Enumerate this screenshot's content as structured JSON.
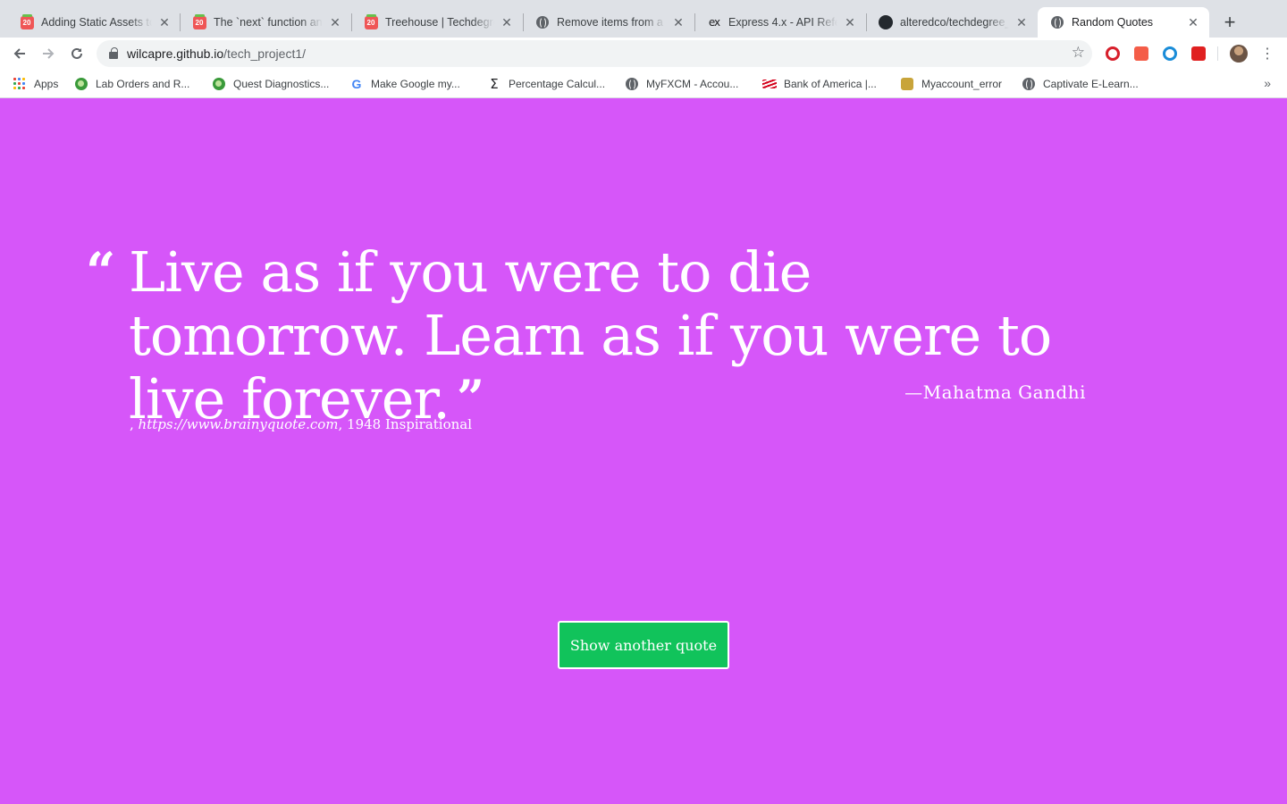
{
  "browser": {
    "tabs": [
      {
        "title": "Adding Static Assets to",
        "favicon": "treehouse-icon",
        "active": false
      },
      {
        "title": "The `next` function an",
        "favicon": "treehouse-icon",
        "active": false
      },
      {
        "title": "Treehouse | Techdegree",
        "favicon": "treehouse-icon",
        "active": false
      },
      {
        "title": "Remove items from a c",
        "favicon": "globe-icon",
        "active": false
      },
      {
        "title": "Express 4.x - API Refer",
        "favicon": "express-icon",
        "active": false
      },
      {
        "title": "alteredco/techdegree_",
        "favicon": "github-icon",
        "active": false
      },
      {
        "title": "Random Quotes",
        "favicon": "globe-icon",
        "active": true
      }
    ],
    "treehouse_badge": "20",
    "express_badge": "ex",
    "new_tab_label": "+",
    "address": {
      "host": "wilcapre.github.io",
      "path": "/tech_project1/"
    },
    "bookmarks": [
      {
        "label": "Apps",
        "icon": "apps-grid-icon"
      },
      {
        "label": "Lab Orders and R...",
        "icon": "green-leaf-icon"
      },
      {
        "label": "Quest Diagnostics...",
        "icon": "green-leaf-icon"
      },
      {
        "label": "Make Google my...",
        "icon": "google-icon"
      },
      {
        "label": "Percentage Calcul...",
        "icon": "sigma-icon"
      },
      {
        "label": "MyFXCM - Accou...",
        "icon": "globe-icon"
      },
      {
        "label": "Bank of America |...",
        "icon": "bank-of-america-icon"
      },
      {
        "label": "Myaccount_error",
        "icon": "user-badge-icon"
      },
      {
        "label": "Captivate E-Learn...",
        "icon": "globe-icon"
      }
    ],
    "google_glyph": "G",
    "sigma_glyph": "Σ",
    "more_bookmarks_glyph": "»"
  },
  "quote": {
    "open_mark": "“",
    "text": "Live as if you were to die tomorrow. Learn as if you were to live forever.",
    "close_mark": "”",
    "source": "—Mahatma Gandhi",
    "citation_prefix": ", ",
    "citation": "https://www.brainyquote.com",
    "year_and_tag": ", 1948 Inspirational"
  },
  "button": {
    "label": "Show another quote"
  },
  "colors": {
    "page_background": "#d656f9",
    "button_background": "#11c35b",
    "text": "#ffffff"
  }
}
